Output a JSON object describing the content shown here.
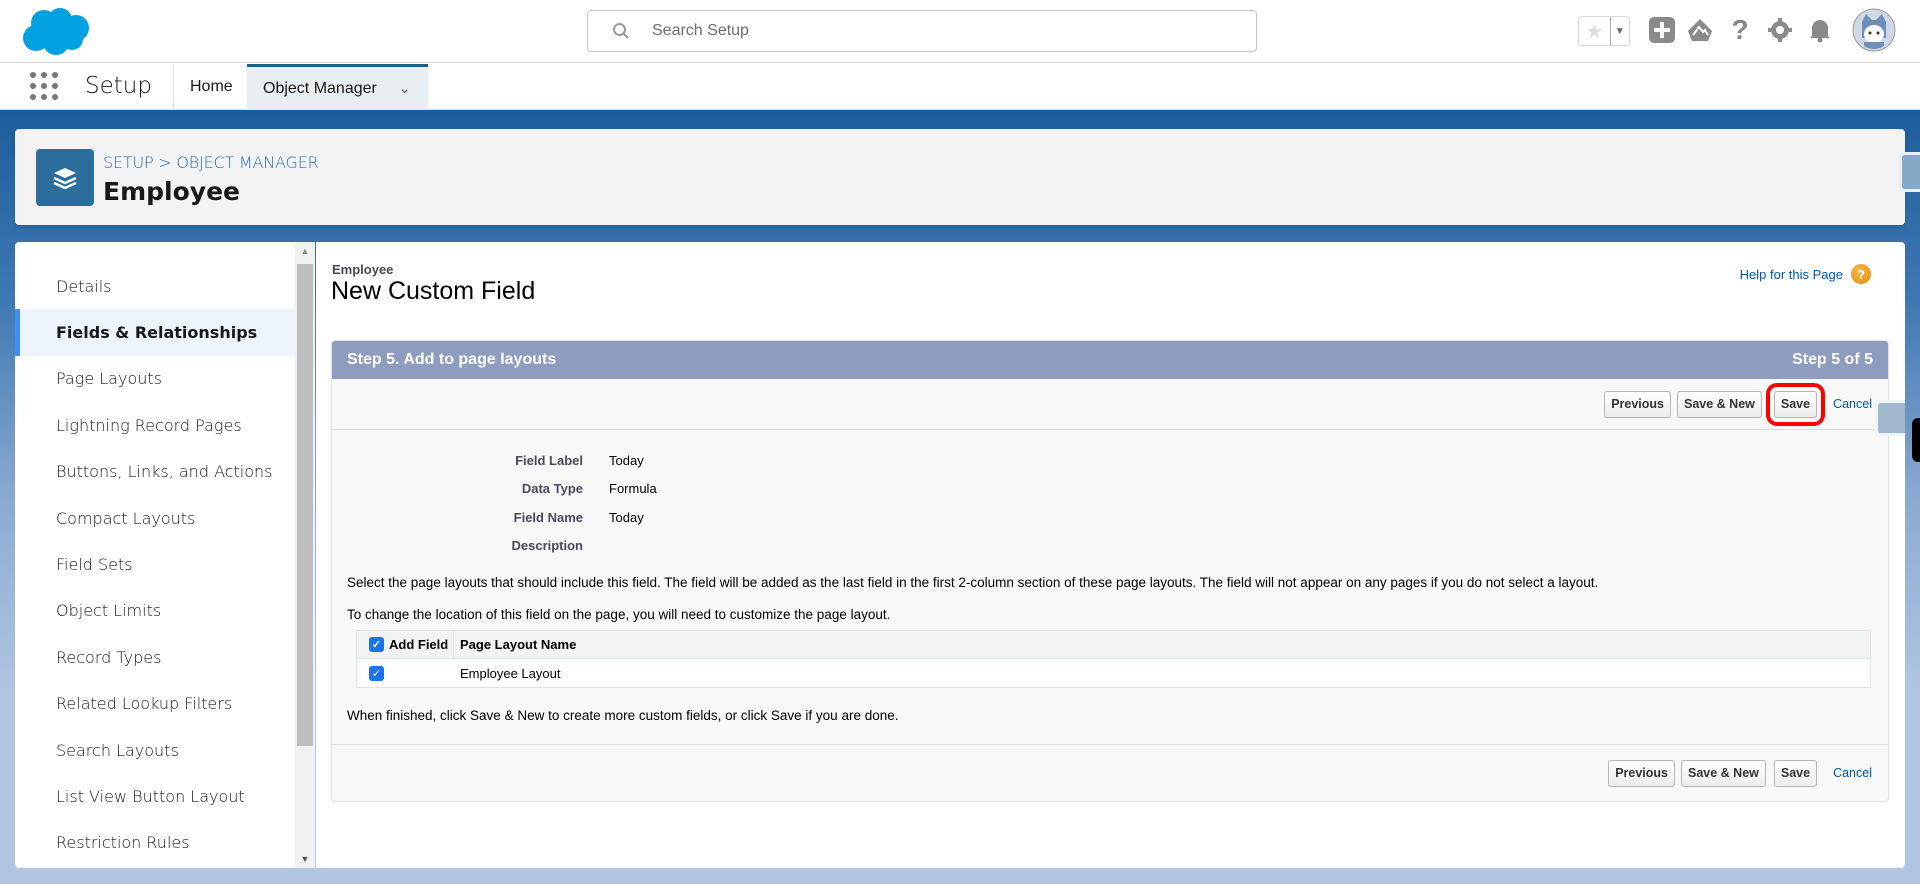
{
  "header": {
    "search_placeholder": "Search Setup"
  },
  "nav": {
    "app_name": "Setup",
    "tabs": [
      {
        "label": "Home"
      },
      {
        "label": "Object Manager"
      }
    ]
  },
  "object_header": {
    "breadcrumb": "SETUP > OBJECT MANAGER",
    "title": "Employee"
  },
  "sidebar": {
    "items": [
      {
        "label": "Details"
      },
      {
        "label": "Fields & Relationships"
      },
      {
        "label": "Page Layouts"
      },
      {
        "label": "Lightning Record Pages"
      },
      {
        "label": "Buttons, Links, and Actions"
      },
      {
        "label": "Compact Layouts"
      },
      {
        "label": "Field Sets"
      },
      {
        "label": "Object Limits"
      },
      {
        "label": "Record Types"
      },
      {
        "label": "Related Lookup Filters"
      },
      {
        "label": "Search Layouts"
      },
      {
        "label": "List View Button Layout"
      },
      {
        "label": "Restriction Rules"
      }
    ],
    "active": "Fields & Relationships"
  },
  "page": {
    "type": "Employee",
    "title": "New Custom Field",
    "help_link": "Help for this Page",
    "step_title": "Step 5. Add to page layouts",
    "step_count": "Step 5 of 5",
    "buttons": {
      "previous": "Previous",
      "save_new": "Save & New",
      "save": "Save",
      "cancel": "Cancel"
    },
    "details": [
      {
        "label": "Field Label",
        "value": "Today"
      },
      {
        "label": "Data Type",
        "value": "Formula"
      },
      {
        "label": "Field Name",
        "value": "Today"
      },
      {
        "label": "Description",
        "value": ""
      }
    ],
    "instruction1": "Select the page layouts that should include this field. The field will be added as the last field in the first 2-column section of these page layouts. The field will not appear on any pages if you do not select a layout.",
    "instruction2": "To change the location of this field on the page, you will need to customize the page layout.",
    "table": {
      "headers": [
        "Add Field",
        "Page Layout Name"
      ],
      "rows": [
        {
          "checked": true,
          "name": "Employee Layout"
        }
      ]
    },
    "finish_note": "When finished, click Save & New to create more custom fields, or click Save if you are done."
  }
}
